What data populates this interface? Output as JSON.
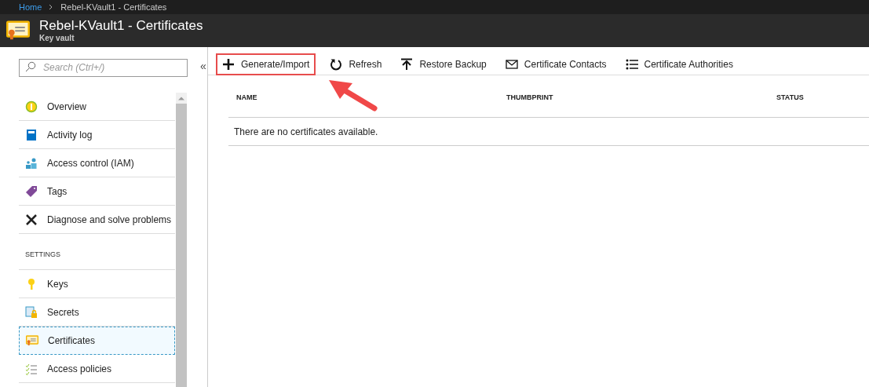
{
  "breadcrumb": [
    {
      "label": "Home",
      "link": true
    },
    {
      "label": "Rebel-KVault1 - Certificates",
      "link": false
    }
  ],
  "header": {
    "title": "Rebel-KVault1 - Certificates",
    "subtitle": "Key vault"
  },
  "sidebar": {
    "search": {
      "placeholder": "Search (Ctrl+/)"
    },
    "collapse": "«",
    "items": [
      {
        "label": "Overview",
        "selected": false
      },
      {
        "label": "Activity log",
        "selected": false
      },
      {
        "label": "Access control (IAM)",
        "selected": false
      },
      {
        "label": "Tags",
        "selected": false
      },
      {
        "label": "Diagnose and solve problems",
        "selected": false
      }
    ],
    "sections": [
      {
        "title": "SETTINGS",
        "items": [
          {
            "label": "Keys",
            "selected": false
          },
          {
            "label": "Secrets",
            "selected": false
          },
          {
            "label": "Certificates",
            "selected": true
          },
          {
            "label": "Access policies",
            "selected": false
          }
        ]
      }
    ]
  },
  "toolbar": [
    {
      "label": "Generate/Import",
      "highlighted": true
    },
    {
      "label": "Refresh",
      "highlighted": false
    },
    {
      "label": "Restore Backup",
      "highlighted": false
    },
    {
      "label": "Certificate Contacts",
      "highlighted": false
    },
    {
      "label": "Certificate Authorities",
      "highlighted": false
    }
  ],
  "table": {
    "columns": [
      "NAME",
      "THUMBPRINT",
      "STATUS"
    ],
    "empty": "There are no certificates available."
  }
}
